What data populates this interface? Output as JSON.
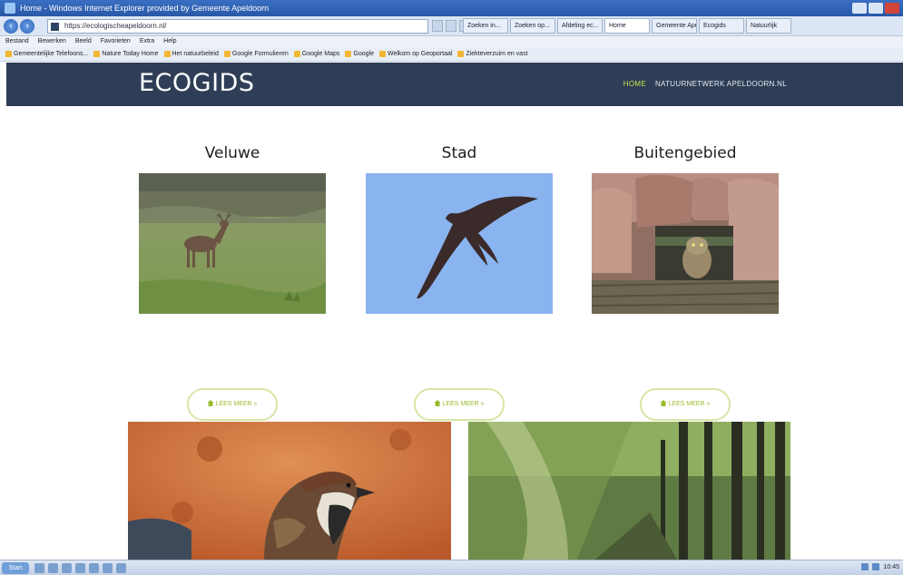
{
  "browser": {
    "title": "Home - Windows Internet Explorer provided by Gemeente Apeldoorn",
    "address": "https://ecologischeapeldoorn.nl/",
    "tabs": [
      "Zoeken in...",
      "Zoeken op...",
      "Afdeling ec...",
      "Home",
      "Gemeente Apeldoorn",
      "Ecogids",
      "Natuurlijk"
    ],
    "menu": [
      "Bestand",
      "Bewerken",
      "Beeld",
      "Favorieten",
      "Extra",
      "Help"
    ],
    "favorites": [
      "Gemeentelijke Telefoons...",
      "Nature Today Home",
      "Het natuurbeleid",
      "Google Formulieren",
      "Google Maps",
      "Google",
      "Welkom op Geoportaal",
      "Ziekteverzuim en vast"
    ]
  },
  "site": {
    "logo": "ECOGIDS",
    "nav": {
      "home": "HOME",
      "other": "NATUURNETWERK APELDOORN.NL"
    }
  },
  "cards": [
    {
      "title": "Veluwe",
      "button": "LEES MEER »"
    },
    {
      "title": "Stad",
      "button": "LEES MEER »"
    },
    {
      "title": "Buitengebied",
      "button": "LEES MEER »"
    }
  ],
  "taskbar": {
    "start": "Start",
    "clock": "10:45"
  },
  "colors": {
    "header": "#2f3e56",
    "accent": "#9abb2d",
    "sky": "#8ab4f0"
  }
}
